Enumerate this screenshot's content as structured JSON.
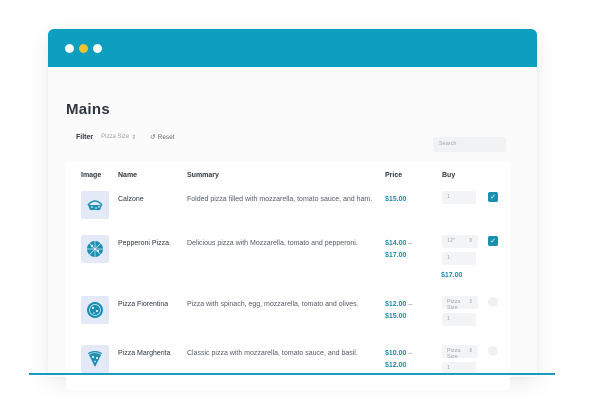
{
  "window": {
    "accent": "#0e9fc0",
    "controls": [
      "close-dot",
      "minimize-dot",
      "maximize-dot"
    ]
  },
  "page": {
    "title": "Mains"
  },
  "filter": {
    "label": "Filter",
    "select": {
      "value": "Pizza Size",
      "arrow": "⇕"
    },
    "reset_label": "Reset",
    "reset_icon": "↺",
    "search_placeholder": "Search"
  },
  "table": {
    "headers": {
      "image": "Image",
      "name": "Name",
      "summary": "Summary",
      "price": "Price",
      "buy": "Buy"
    },
    "rows": [
      {
        "icon": "calzone-icon",
        "name": "Calzone",
        "summary": "Folded pizza filled with mozzarella, tomato sauce, and ham.",
        "price_low": "$15.00",
        "price_high": "",
        "price_dash": "",
        "total": "",
        "size_select": "",
        "quantity": "1",
        "checked": true
      },
      {
        "icon": "pizza-icon",
        "name": "Pepperoni Pizza",
        "summary": "Delicious pizza with Mozzarella, tomato and pepperoni.",
        "price_low": "$14.00",
        "price_dash": "–",
        "price_high": "$17.00",
        "total": "$17.00",
        "size_select": "12\"",
        "quantity": "1",
        "checked": true
      },
      {
        "icon": "pizza-icon",
        "name": "Pizza Fiorentina",
        "summary": "Pizza with spinach, egg, mozzarella, tomato and olives.",
        "price_low": "$12.00",
        "price_dash": "–",
        "price_high": "$15.00",
        "total": "",
        "size_select": "Pizza Size",
        "quantity": "1",
        "checked": false
      },
      {
        "icon": "pizza-slice-icon",
        "name": "Pizza Margherita",
        "summary": "Classic pizza with mozzarella, tomato sauce, and basil.",
        "price_low": "$10.00",
        "price_dash": "–",
        "price_high": "$12.00",
        "total": "",
        "size_select": "Pizza Size",
        "quantity": "1",
        "checked": false
      }
    ],
    "select_arrow": "⇕",
    "check_glyph": "✓"
  },
  "colors": {
    "price": "#1a8fb0",
    "thumb_bg": "#e4e9f8",
    "icon": "#1a8fb0"
  }
}
